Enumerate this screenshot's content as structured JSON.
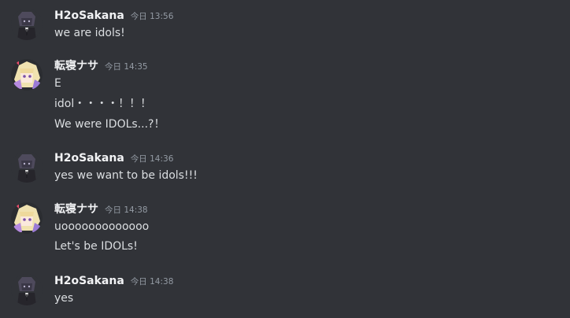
{
  "messages": [
    {
      "author": "H2oSakana",
      "avatar": "hooded-suit-character-avatar",
      "timestamp": "今日 13:56",
      "lines": [
        "we are idols!"
      ]
    },
    {
      "author": "転寝ナサ",
      "avatar": "blonde-anime-girl-avatar",
      "timestamp": "今日 14:35",
      "lines": [
        "E",
        "idol・・・・！！！",
        "We were IDOLs...?！"
      ]
    },
    {
      "author": "H2oSakana",
      "avatar": "hooded-suit-character-avatar",
      "timestamp": "今日 14:36",
      "lines": [
        "yes we want to be idols!!!"
      ]
    },
    {
      "author": "転寝ナサ",
      "avatar": "blonde-anime-girl-avatar",
      "timestamp": "今日 14:38",
      "lines": [
        "uooooooooooooo",
        "Let's be IDOLs!"
      ]
    },
    {
      "author": "H2oSakana",
      "avatar": "hooded-suit-character-avatar",
      "timestamp": "今日 14:38",
      "lines": [
        "yes"
      ]
    }
  ],
  "colors": {
    "background": "#313338",
    "username": "#f2f3f5",
    "timestamp": "#949ba4",
    "message_text": "#dbdee1"
  }
}
